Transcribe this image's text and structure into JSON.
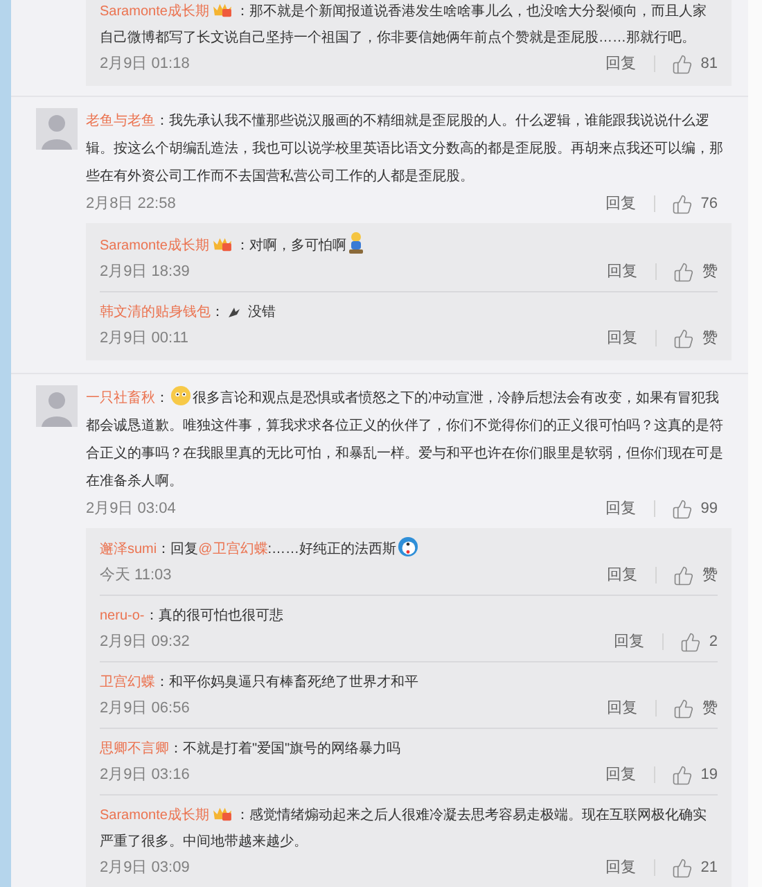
{
  "leading_replies": [
    {
      "name": "Saramonte成长期",
      "badge": true,
      "segments": [
        {
          "kind": "plain",
          "text": "：那不就是个新闻报道说香港发生啥啥事儿么，也没啥大分裂倾向，而且人家自己微博都写了长文说自己坚持一个祖国了，你非要信她俩年前点个赞就是歪屁股……那就行吧。"
        }
      ],
      "time": "2月9日 01:18",
      "reply": "回复",
      "like": "81"
    }
  ],
  "comments": [
    {
      "name": "老鱼与老鱼",
      "badge": false,
      "segments": [
        {
          "kind": "plain",
          "text": "：我先承认我不懂那些说汉服画的不精细就是歪屁股的人。什么逻辑，谁能跟我说说什么逻辑。按这么个胡编乱造法，我也可以说学校里英语比语文分数高的都是歪屁股。再胡来点我还可以编，那些在有外资公司工作而不去国营私营公司工作的人都是歪屁股。"
        }
      ],
      "time": "2月8日 22:58",
      "reply": "回复",
      "like": "76",
      "replies": [
        {
          "name": "Saramonte成长期",
          "badge": true,
          "segments": [
            {
              "kind": "plain",
              "text": "：对啊，多可怕啊"
            },
            {
              "kind": "figure"
            }
          ],
          "time": "2月9日 18:39",
          "reply": "回复",
          "like": "赞"
        },
        {
          "name": "韩文清的贴身钱包",
          "badge": false,
          "segments": [
            {
              "kind": "plain",
              "text": "："
            },
            {
              "kind": "sparkle"
            },
            {
              "kind": "plain",
              "text": " 没错"
            }
          ],
          "time": "2月9日 00:11",
          "reply": "回复",
          "like": "赞"
        }
      ]
    },
    {
      "name": "一只社畜秋",
      "badge": false,
      "segments": [
        {
          "kind": "plain",
          "text": "："
        },
        {
          "kind": "face"
        },
        {
          "kind": "plain",
          "text": "很多言论和观点是恐惧或者愤怒之下的冲动宣泄，冷静后想法会有改变，如果有冒犯我都会诚恳道歉。唯独这件事，算我求求各位正义的伙伴了，你们不觉得你们的正义很可怕吗？这真的是符合正义的事吗？在我眼里真的无比可怕，和暴乱一样。爱与和平也许在你们眼里是软弱，但你们现在可是在准备杀人啊。"
        }
      ],
      "time": "2月9日 03:04",
      "reply": "回复",
      "like": "99",
      "replies": [
        {
          "name": "邂泽sumi",
          "badge": false,
          "segments": [
            {
              "kind": "plain",
              "text": "：回复"
            },
            {
              "kind": "mention",
              "text": "@卫宫幻蝶"
            },
            {
              "kind": "plain",
              "text": ":……好纯正的法西斯"
            },
            {
              "kind": "round"
            }
          ],
          "time": "今天 11:03",
          "reply": "回复",
          "like": "赞"
        },
        {
          "name": "neru-o-",
          "badge": false,
          "segments": [
            {
              "kind": "plain",
              "text": "：真的很可怕也很可悲"
            }
          ],
          "time": "2月9日 09:32",
          "reply": "回复",
          "like": "2"
        },
        {
          "name": "卫宫幻蝶",
          "badge": false,
          "segments": [
            {
              "kind": "plain",
              "text": "：和平你妈臭逼只有棒畜死绝了世界才和平"
            }
          ],
          "time": "2月9日 06:56",
          "reply": "回复",
          "like": "赞"
        },
        {
          "name": "思卿不言卿",
          "badge": false,
          "segments": [
            {
              "kind": "plain",
              "text": "：不就是打着\"爱国\"旗号的网络暴力吗"
            }
          ],
          "time": "2月9日 03:16",
          "reply": "回复",
          "like": "19"
        },
        {
          "name": "Saramonte成长期",
          "badge": true,
          "segments": [
            {
              "kind": "plain",
              "text": "：感觉情绪煽动起来之后人很难冷凝去思考容易走极端。现在互联网极化确实严重了很多。中间地带越来越少。"
            }
          ],
          "time": "2月9日 03:09",
          "reply": "回复",
          "like": "21"
        }
      ]
    }
  ]
}
